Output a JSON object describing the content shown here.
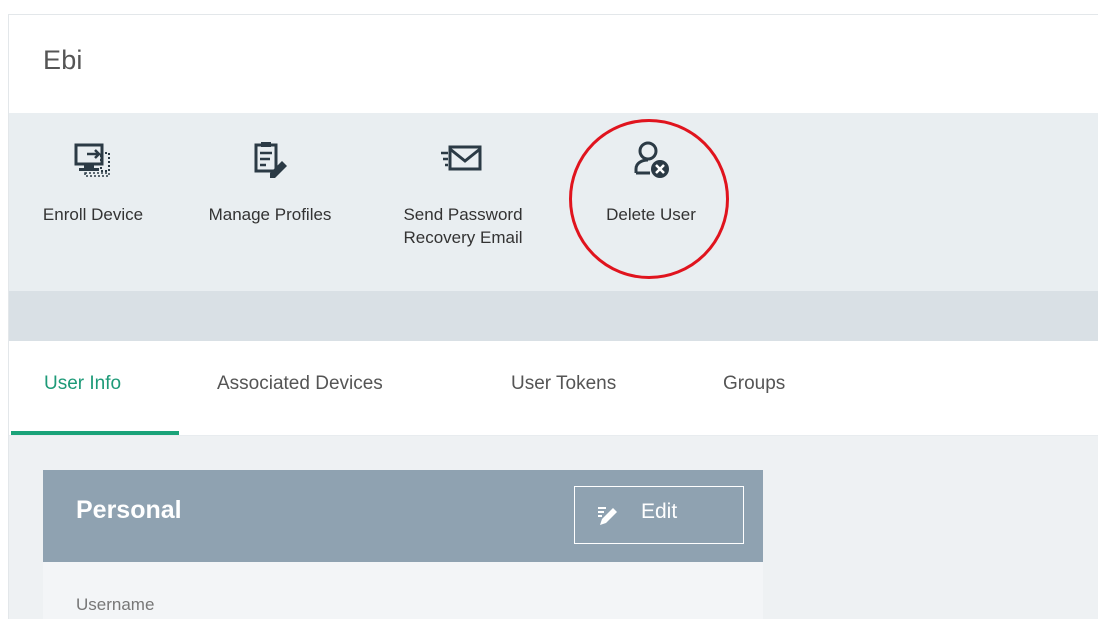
{
  "page": {
    "title": "Ebi"
  },
  "toolbar": {
    "items": [
      {
        "label": "Enroll Device",
        "icon": "enroll-device-icon"
      },
      {
        "label": "Manage Profiles",
        "icon": "manage-profiles-icon"
      },
      {
        "label_line1": "Send Password",
        "label_line2": "Recovery Email",
        "icon": "envelope-icon"
      },
      {
        "label": "Delete User",
        "icon": "delete-user-icon"
      }
    ],
    "highlight_color": "#e0141e"
  },
  "tabs": {
    "items": [
      "User Info",
      "Associated Devices",
      "User Tokens",
      "Groups"
    ],
    "active": "User Info",
    "active_color": "#1aa379"
  },
  "personal": {
    "title": "Personal",
    "edit_label": "Edit",
    "fields": [
      "Username"
    ]
  }
}
